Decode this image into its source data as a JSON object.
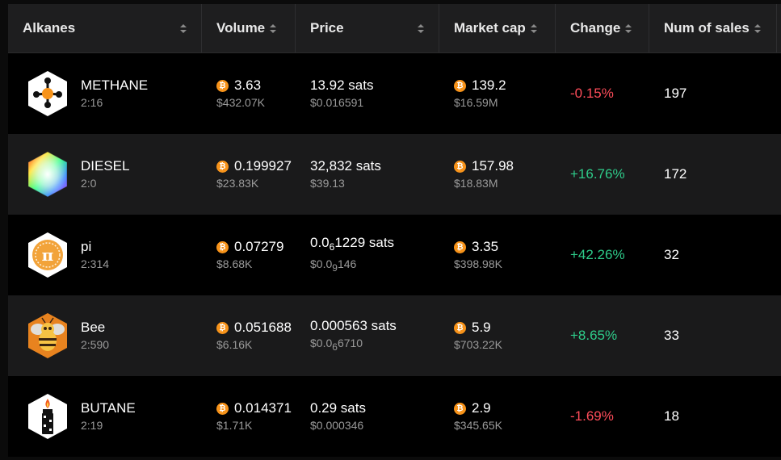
{
  "headers": [
    "Alkanes",
    "Volume",
    "Price",
    "Market cap",
    "Change",
    "Num of sales"
  ],
  "btc_symbol": "₿",
  "rows": [
    {
      "icon": "methane-molecule-icon",
      "name": "METHANE",
      "id": "2:16",
      "volume_btc": "3.63",
      "volume_usd": "$432.07K",
      "price_sats": "13.92 sats",
      "price_usd": "$0.016591",
      "mcap_btc": "139.2",
      "mcap_usd": "$16.59M",
      "change": "-0.15%",
      "sales": "197"
    },
    {
      "icon": "diesel-rainbow-icon",
      "name": "DIESEL",
      "id": "2:0",
      "volume_btc": "0.199927",
      "volume_usd": "$23.83K",
      "price_sats": "32,832 sats",
      "price_usd": "$39.13",
      "mcap_btc": "157.98",
      "mcap_usd": "$18.83M",
      "change": "+16.76%",
      "sales": "172"
    },
    {
      "icon": "pi-symbol-icon",
      "name": "pi",
      "id": "2:314",
      "volume_btc": "0.07279",
      "volume_usd": "$8.68K",
      "price_sats_prefix": "0.0",
      "price_sats_zeros": "6",
      "price_sats_rest": "1229 sats",
      "price_usd_prefix": "$0.0",
      "price_usd_zeros": "9",
      "price_usd_rest": "146",
      "mcap_btc": "3.35",
      "mcap_usd": "$398.98K",
      "change": "+42.26%",
      "sales": "32"
    },
    {
      "icon": "bee-icon",
      "name": "Bee",
      "id": "2:590",
      "volume_btc": "0.051688",
      "volume_usd": "$6.16K",
      "price_sats": "0.000563 sats",
      "price_usd_prefix": "$0.0",
      "price_usd_zeros": "6",
      "price_usd_rest": "6710",
      "mcap_btc": "5.9",
      "mcap_usd": "$703.22K",
      "change": "+8.65%",
      "sales": "33"
    },
    {
      "icon": "butane-lighter-icon",
      "name": "BUTANE",
      "id": "2:19",
      "volume_btc": "0.014371",
      "volume_usd": "$1.71K",
      "price_sats": "0.29 sats",
      "price_usd": "$0.000346",
      "mcap_btc": "2.9",
      "mcap_usd": "$345.65K",
      "change": "-1.69%",
      "sales": "18"
    }
  ],
  "colors": {
    "negative": "#ff4d5a",
    "positive": "#2ecc8a",
    "btc": "#f7931a"
  }
}
